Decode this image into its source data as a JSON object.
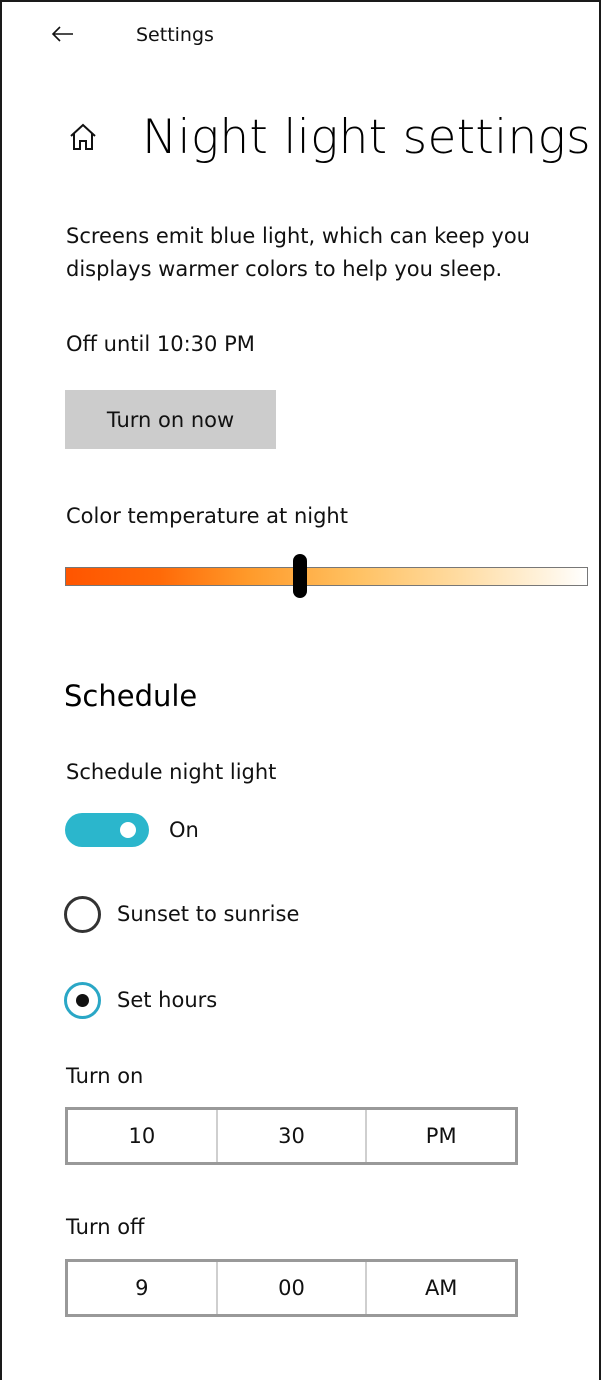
{
  "window": {
    "title": "Settings"
  },
  "header": {
    "title": "Night light settings",
    "home_icon": "home-icon",
    "back_icon": "back-arrow-icon"
  },
  "description": "Screens emit blue light, which can keep you\ndisplays warmer colors to help you sleep.",
  "status_text": "Off until 10:30 PM",
  "turn_on_button": "Turn on now",
  "color_temperature": {
    "label": "Color temperature at night",
    "value_fraction": 0.45,
    "gradient_colors": [
      "#ff5500",
      "#ff9a2a",
      "#ffc060",
      "#ffdba0",
      "#ffffff"
    ]
  },
  "schedule": {
    "heading": "Schedule",
    "toggle_label": "Schedule night light",
    "toggle_state": "On",
    "toggle_on": true,
    "toggle_color": "#2bb6cc",
    "options": [
      {
        "label": "Sunset to sunrise",
        "selected": false
      },
      {
        "label": "Set hours",
        "selected": true
      }
    ],
    "turn_on": {
      "label": "Turn on",
      "hour": "10",
      "minute": "30",
      "period": "PM"
    },
    "turn_off": {
      "label": "Turn off",
      "hour": "9",
      "minute": "00",
      "period": "AM"
    }
  }
}
